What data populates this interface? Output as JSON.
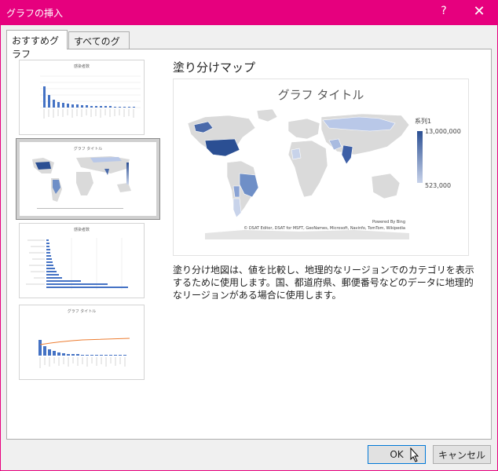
{
  "window": {
    "title": "グラフの挿入",
    "help": "?",
    "close": "✕"
  },
  "tabs": [
    {
      "label": "おすすめグラフ",
      "active": true
    },
    {
      "label": "すべてのグラフ",
      "active": false
    }
  ],
  "thumbnails": [
    {
      "title": "感染者数",
      "type": "bar"
    },
    {
      "title": "グラフ タイトル",
      "type": "map",
      "selected": true
    },
    {
      "title": "感染者数",
      "type": "horizontal-bar"
    },
    {
      "title": "グラフ タイトル",
      "type": "pareto"
    }
  ],
  "preview": {
    "heading": "塗り分けマップ",
    "chart_title": "グラフ タイトル",
    "legend": {
      "series": "系列1",
      "max": "13,000,000",
      "min": "523,000"
    },
    "powered_by": "Powered By Bing",
    "credits": "© DSAT Editor, DSAT for MSFT, GeoNames, Microsoft, Navinfo, TomTom, Wikipedia"
  },
  "description": "塗り分け地図は、値を比較し、地理的なリージョンでのカテゴリを表示するために使用します。国、都道府県、郵便番号などのデータに地理的なリージョンがある場合に使用します。",
  "buttons": {
    "ok": "OK",
    "cancel": "キャンセル"
  },
  "colors": {
    "accent": "#e6007e",
    "map_dark": "#2b4f93",
    "map_light": "#c8d3ea"
  }
}
